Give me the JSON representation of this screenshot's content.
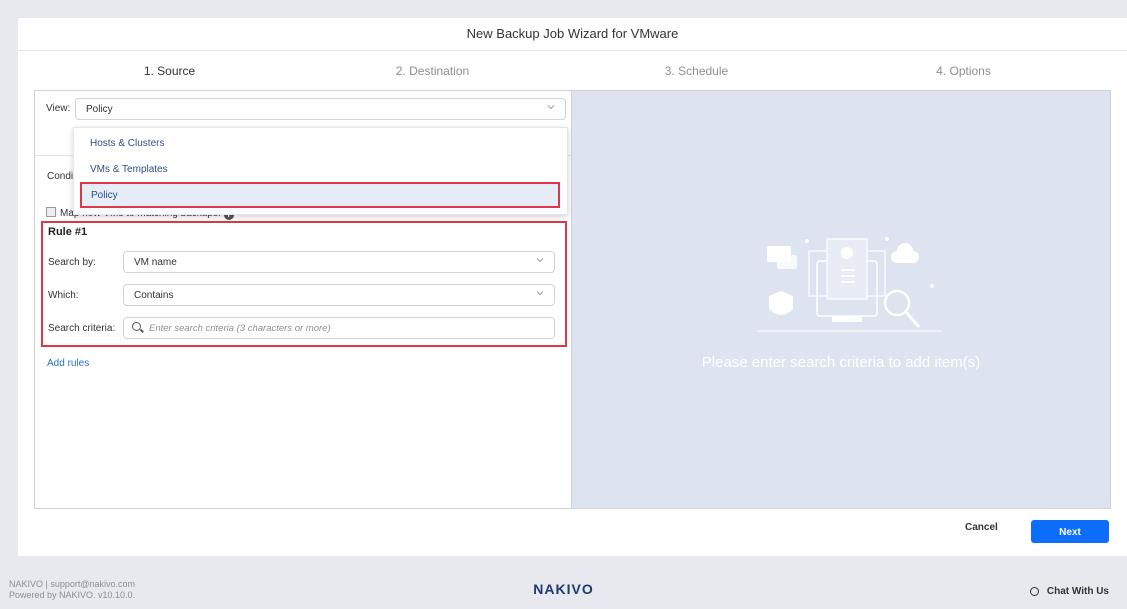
{
  "window": {
    "title": "New Backup Job Wizard for VMware"
  },
  "steps": [
    {
      "label": "1. Source"
    },
    {
      "label": "2. Destination"
    },
    {
      "label": "3. Schedule"
    },
    {
      "label": "4. Options"
    }
  ],
  "source": {
    "view_label": "View:",
    "view_value": "Policy",
    "view_options": [
      "Hosts & Clusters",
      "VMs & Templates",
      "Policy"
    ],
    "conditions_label": "Conditi",
    "map_new_vms_label": "Map new VMs to matching backups.",
    "rule_title": "Rule #1",
    "search_by_label": "Search by:",
    "search_by_value": "VM name",
    "which_label": "Which:",
    "which_value": "Contains",
    "criteria_label": "Search criteria:",
    "criteria_placeholder": "Enter search criteria (3 characters or more)",
    "add_rules": "Add rules"
  },
  "right_panel": {
    "message": "Please enter search criteria to add item(s)"
  },
  "buttons": {
    "cancel": "Cancel",
    "next": "Next"
  },
  "footer": {
    "line1": "NAKIVO | support@nakivo.com",
    "line2": "Powered by NAKIVO. v10.10.0.",
    "logo": "NAKIVO",
    "chat": "Chat With Us"
  },
  "colors": {
    "accent": "#0d6efd",
    "highlight": "#d9394a",
    "panel_bg": "#dde4ef"
  }
}
